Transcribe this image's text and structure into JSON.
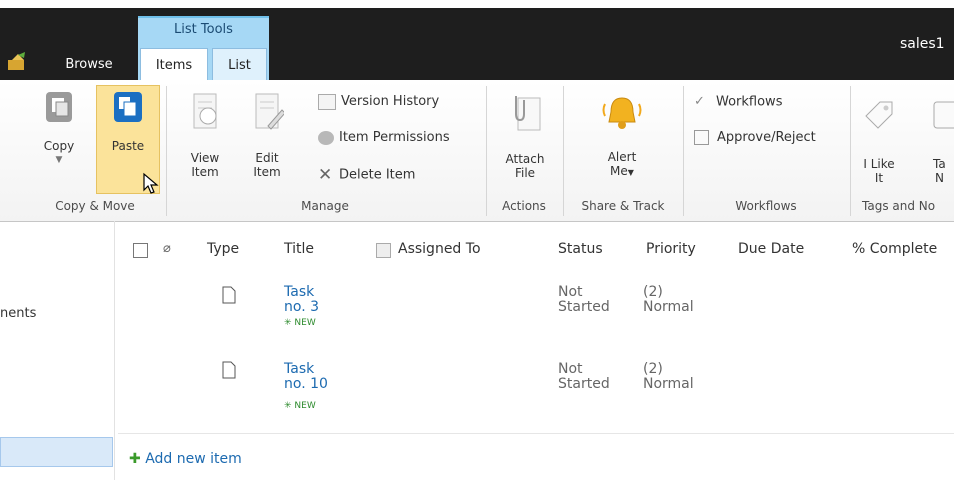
{
  "ribbon_tabs": {
    "context_group": "List Tools",
    "browse": "Browse",
    "items": "Items",
    "list": "List"
  },
  "user": {
    "name": "sales1"
  },
  "ribbon": {
    "copy_label": "Copy",
    "paste_label": "Paste",
    "copy_move_group": "Copy & Move",
    "view_item": [
      "View",
      "Item"
    ],
    "edit_item": [
      "Edit",
      "Item"
    ],
    "version_history": "Version History",
    "item_permissions": "Item Permissions",
    "delete_item": "Delete Item",
    "manage_group": "Manage",
    "attach_file": [
      "Attach",
      "File"
    ],
    "actions_group": "Actions",
    "alert_me": [
      "Alert",
      "Me"
    ],
    "share_track_group": "Share & Track",
    "workflows": "Workflows",
    "approve_reject": "Approve/Reject",
    "workflows_group": "Workflows",
    "i_like_it": [
      "I Like",
      "It"
    ],
    "tags_notes_partial": [
      "Ta",
      "N"
    ],
    "tags_notes_group": "Tags and No"
  },
  "nav": {
    "partial_item": "nents"
  },
  "list": {
    "columns": [
      "Type",
      "Title",
      "Assigned To",
      "Status",
      "Priority",
      "Due Date",
      "% Complete"
    ],
    "rows": [
      {
        "title": [
          "Task",
          "no. 3"
        ],
        "badge": "NEW",
        "status": [
          "Not",
          "Started"
        ],
        "priority": [
          "(2)",
          "Normal"
        ]
      },
      {
        "title": [
          "Task",
          "no. 10"
        ],
        "badge": "NEW",
        "status": [
          "Not",
          "Started"
        ],
        "priority": [
          "(2)",
          "Normal"
        ]
      }
    ],
    "add_new_item": "Add new item"
  },
  "colors": {
    "topbar": "#1e1e1e",
    "context_tab": "#a6d8f5",
    "link": "#1c6ab0",
    "paste_highlight": "#fbe39a"
  }
}
